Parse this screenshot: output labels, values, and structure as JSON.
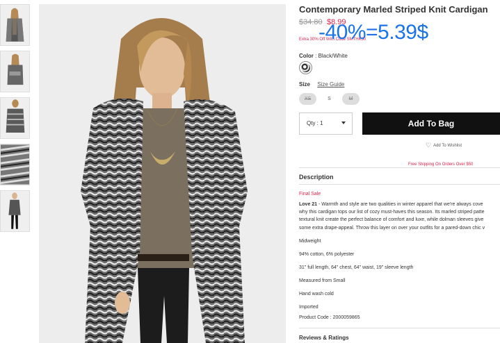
{
  "product": {
    "title": "Contemporary Marled Striped Knit Cardigan",
    "original_price": "$34.80",
    "sale_price": "$8.99",
    "promo_text": "Extra 30% Off With Code SMTHK30",
    "overlay_discount": "-40%=5.39$",
    "color_label": "Color",
    "color_value": "Black/White",
    "size_label": "Size",
    "size_guide": "Size Guide",
    "sizes": [
      {
        "label": "XS",
        "available": false
      },
      {
        "label": "S",
        "available": true
      },
      {
        "label": "M",
        "available": false
      }
    ],
    "qty_label": "Qty : 1",
    "add_to_bag": "Add To Bag",
    "wishlist": "Add To Wishlist",
    "free_shipping": "Free Shipping On Orders Over $50",
    "description_heading": "Description",
    "final_sale": "Final Sale",
    "desc_brand": "Love 21",
    "desc_lines": [
      " - Warmth and style are two qualities in winter apparel that we're always cove",
      "why this cardigan tops our list of cozy must-haves this season. Its marled striped patte",
      "textural knit create the perfect balance of comfort and luxe, while dolman sleeves give",
      "some extra drape-appeal. Throw this layer on over your outfits for a pared-down chic v"
    ],
    "specs": [
      "Midweight",
      "94% cotton, 6% polyester",
      "31\" full length, 64\" chest, 64\" waist, 19\" sleeve length",
      "Measured from Small",
      "Hand wash cold",
      "Imported",
      "Product Code : 2000059865"
    ],
    "reviews_heading": "Reviews & Ratings"
  },
  "colors": {
    "sale": "#e0234b",
    "overlay": "#1a73e8",
    "button_bg": "#111111"
  },
  "icons": {
    "heart": "heart-icon",
    "caret": "chevron-down-icon"
  }
}
